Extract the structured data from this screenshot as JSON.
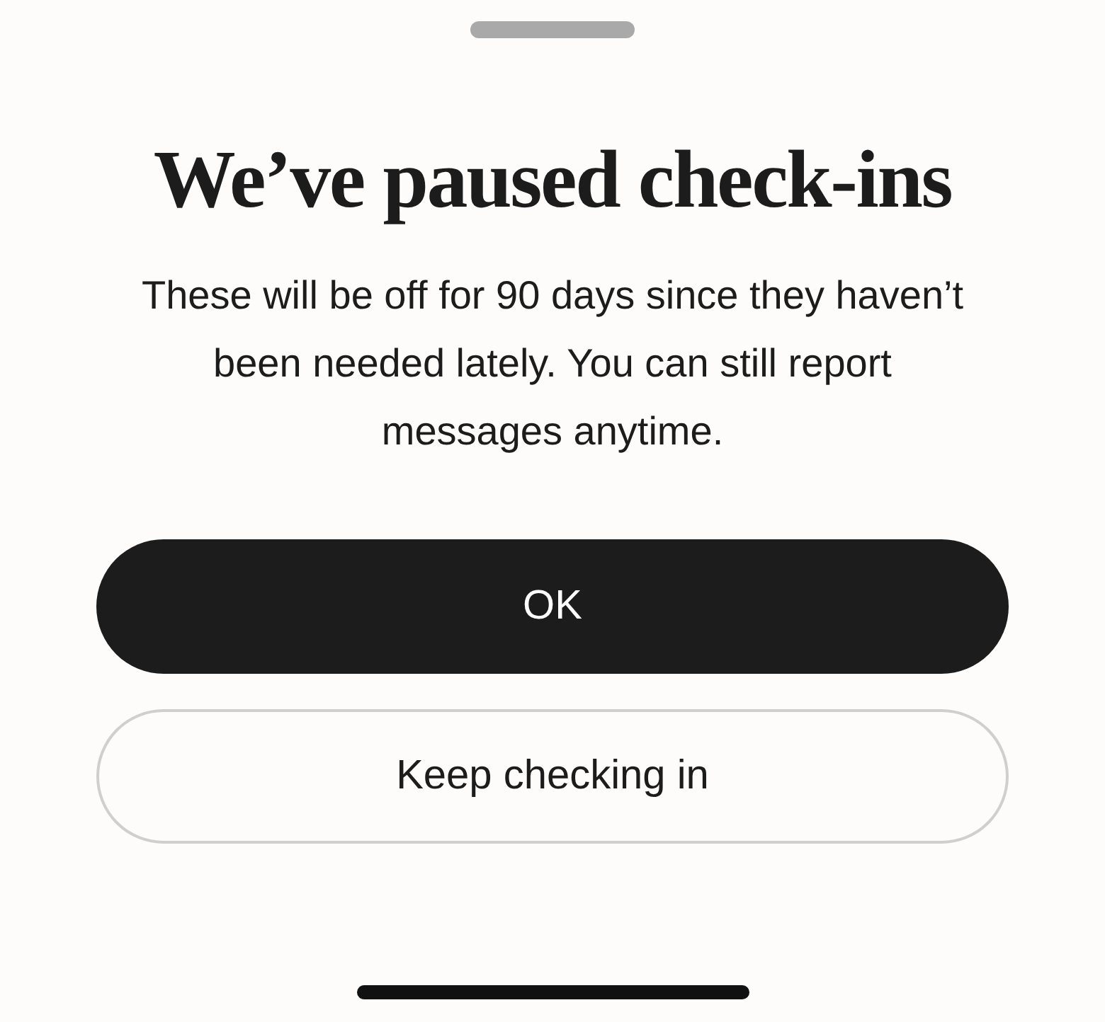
{
  "title": "We’ve paused check-ins",
  "body": "These will be off for 90 days since they haven’t been needed lately. You can still report messages anytime.",
  "buttons": [
    {
      "label": "OK",
      "kind": "primary"
    },
    {
      "label": "Keep checking in",
      "kind": "secondary"
    }
  ]
}
